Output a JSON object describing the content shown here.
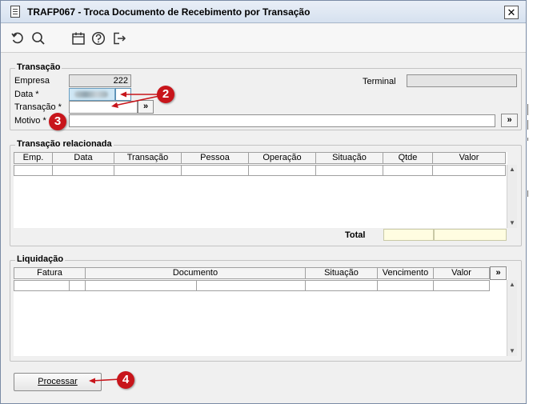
{
  "window": {
    "title": "TRAFP067 - Troca Documento de Recebimento por Transação",
    "close_label": "✕"
  },
  "toolbar": {
    "icons": [
      "undo-icon",
      "search-icon",
      "calendar-icon",
      "help-icon",
      "exit-icon"
    ]
  },
  "transacao_group": {
    "legend": "Transação",
    "empresa_label": "Empresa",
    "empresa_value": "222",
    "data_label": "Data *",
    "transacao_label": "Transação *",
    "transacao_button": "»",
    "motivo_label": "Motivo *",
    "motivo_button": "»",
    "terminal_label": "Terminal",
    "terminal_value": ""
  },
  "transacao_relacionada": {
    "legend": "Transação relacionada",
    "columns": [
      "Emp.",
      "Data",
      "Transação",
      "Pessoa",
      "Operação",
      "Situação",
      "Qtde",
      "Valor"
    ],
    "total_label": "Total"
  },
  "liquidacao": {
    "legend": "Liquidação",
    "columns": [
      "Fatura",
      "Documento",
      "Situação",
      "Vencimento",
      "Valor"
    ],
    "more_button": "»"
  },
  "actions": {
    "processar_label": "Processar"
  },
  "annotations": {
    "badge_2": "2",
    "badge_3": "3",
    "badge_4": "4"
  },
  "colors": {
    "badge": "#c8151b",
    "title_bar": "#d6e1ef",
    "total_field": "#fffde1",
    "selected_field": "#cfe7f5"
  }
}
